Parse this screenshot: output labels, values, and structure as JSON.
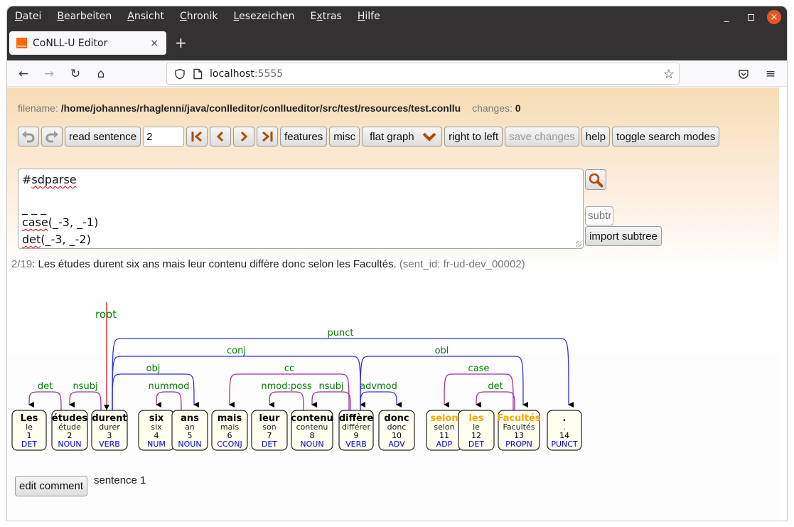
{
  "browser": {
    "menu": [
      {
        "label": "Datei",
        "accel": "D"
      },
      {
        "label": "Bearbeiten",
        "accel": "B"
      },
      {
        "label": "Ansicht",
        "accel": "A"
      },
      {
        "label": "Chronik",
        "accel": "C"
      },
      {
        "label": "Lesezeichen",
        "accel": "L"
      },
      {
        "label": "Extras",
        "accel": "x"
      },
      {
        "label": "Hilfe",
        "accel": "H"
      }
    ],
    "tab_title": "CoNLL-U Editor",
    "url_host": "localhost",
    "url_port": ":5555",
    "icons": {
      "back": "←",
      "forward": "→",
      "reload": "↻",
      "home": "⌂",
      "star": "☆",
      "close_tab": "×",
      "new_tab": "+",
      "menu": "≡",
      "minimize": "_",
      "close_window": "×"
    }
  },
  "app": {
    "filename_label": "filename:",
    "filename": "/home/johannes/rhaglenni/java/conlleditor/conllueditor/src/test/resources/test.conllu",
    "changes_label": "changes:",
    "changes": "0",
    "toolbar": {
      "undo": "↶",
      "redo": "↷",
      "read_sentence": "read sentence",
      "sentence_number": "2",
      "first": "|<",
      "prev": "<",
      "next": ">",
      "last": ">|",
      "features": "features",
      "misc": "misc",
      "graph_mode": "flat graph",
      "right_to_left": "right to left",
      "save_changes": "save changes",
      "help": "help",
      "toggle_search_modes": "toggle search modes"
    },
    "search": {
      "lines": [
        "#sdparse",
        "",
        "_ _ _",
        "case(_-3, _-1)",
        "det(_-3, _-2)"
      ],
      "subtree_placeholder": "subtree",
      "import_subtree": "import subtree"
    },
    "sentence": {
      "position": "2/19",
      "text": "Les études durent six ans mais leur contenu diffère donc selon les Facultés.",
      "sent_id": "(sent_id: fr-ud-dev_00002)"
    },
    "comment": {
      "edit_button": "edit comment",
      "text": "sentence 1"
    }
  },
  "colors": {
    "highlight": "#ffa500",
    "upos": "#0000dd",
    "deprel": "#008000",
    "root_line": "#dd0000",
    "arc_head_left": "#993399",
    "arc_head_right": "#3333dd",
    "node_fill": "#fffff0"
  },
  "tree": {
    "root_label": "root",
    "root_token": 3,
    "tokens": [
      {
        "id": 1,
        "form": "Les",
        "lemma": "le",
        "upos": "DET",
        "head": 2,
        "deprel": "det",
        "hl": false
      },
      {
        "id": 2,
        "form": "études",
        "lemma": "étude",
        "upos": "NOUN",
        "head": 3,
        "deprel": "nsubj",
        "hl": false
      },
      {
        "id": 3,
        "form": "durent",
        "lemma": "durer",
        "upos": "VERB",
        "head": 0,
        "deprel": "root",
        "hl": false
      },
      {
        "id": 4,
        "form": "six",
        "lemma": "six",
        "upos": "NUM",
        "head": 5,
        "deprel": "nummod",
        "hl": false
      },
      {
        "id": 5,
        "form": "ans",
        "lemma": "an",
        "upos": "NOUN",
        "head": 3,
        "deprel": "obj",
        "hl": false
      },
      {
        "id": 6,
        "form": "mais",
        "lemma": "mais",
        "upos": "CCONJ",
        "head": 9,
        "deprel": "cc",
        "hl": false
      },
      {
        "id": 7,
        "form": "leur",
        "lemma": "son",
        "upos": "DET",
        "head": 8,
        "deprel": "nmod:poss",
        "hl": false
      },
      {
        "id": 8,
        "form": "contenu",
        "lemma": "contenu",
        "upos": "NOUN",
        "head": 9,
        "deprel": "nsubj",
        "hl": false
      },
      {
        "id": 9,
        "form": "diffère",
        "lemma": "différer",
        "upos": "VERB",
        "head": 3,
        "deprel": "conj",
        "hl": false
      },
      {
        "id": 10,
        "form": "donc",
        "lemma": "donc",
        "upos": "ADV",
        "head": 9,
        "deprel": "advmod",
        "hl": false
      },
      {
        "id": 11,
        "form": "selon",
        "lemma": "selon",
        "upos": "ADP",
        "head": 13,
        "deprel": "case",
        "hl": true
      },
      {
        "id": 12,
        "form": "les",
        "lemma": "le",
        "upos": "DET",
        "head": 13,
        "deprel": "det",
        "hl": true
      },
      {
        "id": 13,
        "form": "Facultés",
        "lemma": "Facultés",
        "upos": "PROPN",
        "head": 9,
        "deprel": "obl",
        "hl": true
      },
      {
        "id": 14,
        "form": ".",
        "lemma": ".",
        "upos": "PUNCT",
        "head": 3,
        "deprel": "punct",
        "hl": false
      }
    ]
  }
}
